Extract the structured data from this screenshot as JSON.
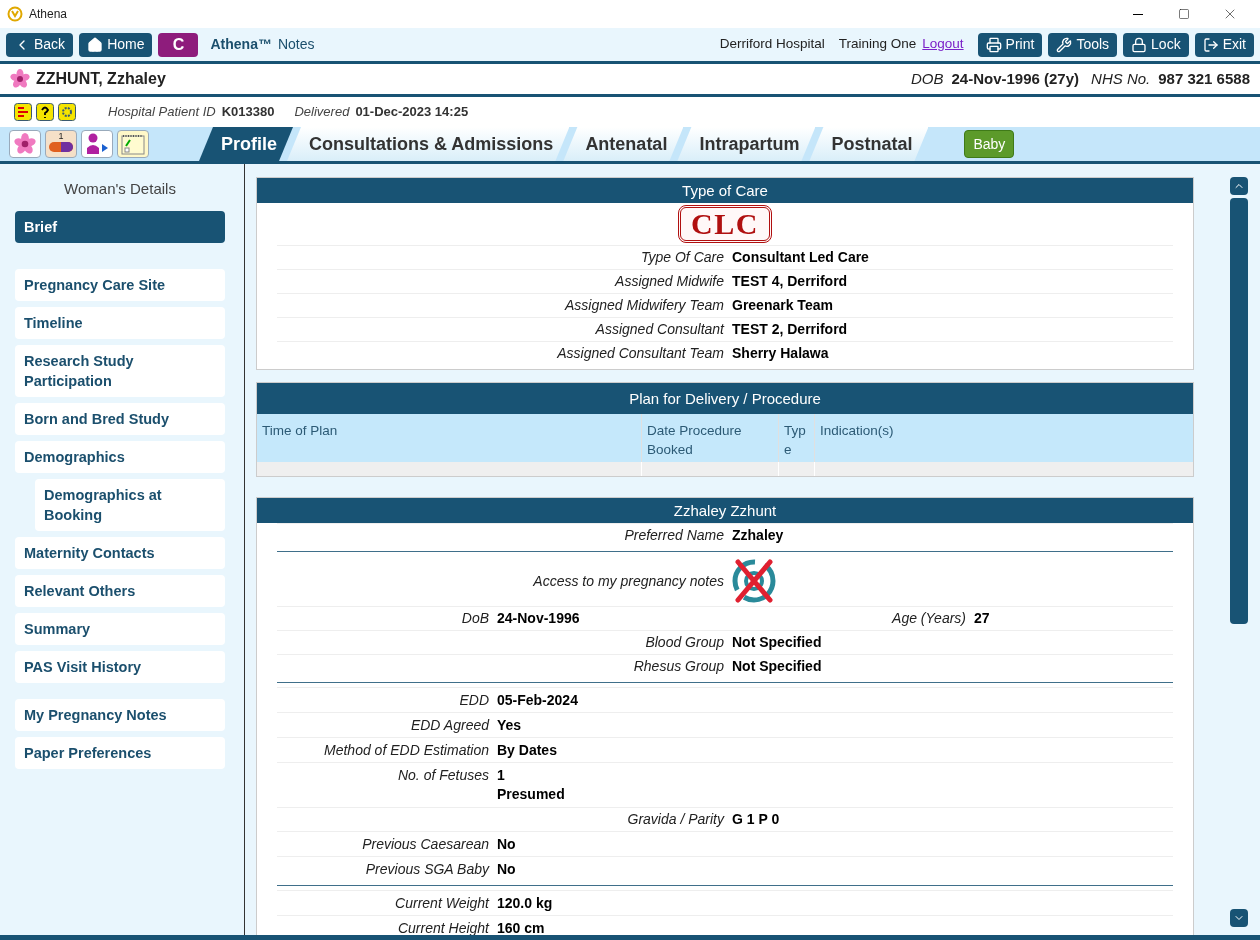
{
  "window": {
    "title": "Athena"
  },
  "toolbar": {
    "left_buttons": [
      {
        "kind": "back",
        "label": "Back"
      },
      {
        "kind": "home",
        "label": "Home"
      }
    ],
    "badge": "C",
    "app_name": "Athena™",
    "app_suffix": "Notes",
    "hospital": "Derriford Hospital",
    "user": "Training One",
    "logout": "Logout",
    "right_buttons": [
      {
        "kind": "print",
        "label": "Print"
      },
      {
        "kind": "tools",
        "label": "Tools"
      },
      {
        "kind": "lock",
        "label": "Lock"
      },
      {
        "kind": "exit",
        "label": "Exit"
      }
    ]
  },
  "patient": {
    "name": "ZZHUNT, Zzhaley",
    "dob_label": "DOB",
    "dob": "24-Nov-1996 (27y)",
    "nhs_label": "NHS No.",
    "nhs": "987 321 6588",
    "id_label": "Hospital Patient ID",
    "id": "K013380",
    "delivered_label": "Delivered",
    "delivered": "01-Dec-2023 14:25"
  },
  "tool_icons": {
    "pill_count": "1"
  },
  "tabs": [
    {
      "label": "Profile",
      "selected": true
    },
    {
      "label": "Consultations & Admissions",
      "selected": false
    },
    {
      "label": "Antenatal",
      "selected": false
    },
    {
      "label": "Intrapartum",
      "selected": false
    },
    {
      "label": "Postnatal",
      "selected": false
    }
  ],
  "baby_button": "Baby",
  "sidebar": {
    "heading": "Woman's Details",
    "groups": [
      [
        {
          "label": "Brief",
          "selected": true
        }
      ],
      [
        {
          "label": "Pregnancy Care Site",
          "selected": false
        },
        {
          "label": "Timeline",
          "selected": false
        },
        {
          "label": "Research Study Participation",
          "selected": false
        },
        {
          "label": "Born and Bred Study",
          "selected": false
        },
        {
          "label": "Demographics",
          "selected": false,
          "children": [
            {
              "label": "Demographics at Booking",
              "selected": false
            }
          ]
        },
        {
          "label": "Maternity Contacts",
          "selected": false
        },
        {
          "label": "Relevant Others",
          "selected": false
        },
        {
          "label": "Summary",
          "selected": false
        },
        {
          "label": "PAS Visit History",
          "selected": false
        }
      ],
      [
        {
          "label": "My Pregnancy Notes",
          "selected": false
        },
        {
          "label": "Paper Preferences",
          "selected": false
        }
      ]
    ]
  },
  "type_of_care": {
    "title": "Type of Care",
    "stamp": "CLC",
    "rows": [
      {
        "label": "Type Of Care",
        "value": "Consultant Led Care"
      },
      {
        "label": "Assigned Midwife",
        "value": "TEST 4, Derriford"
      },
      {
        "label": "Assigned Midwifery Team",
        "value": "Greenark Team"
      },
      {
        "label": "Assigned Consultant",
        "value": "TEST 2, Derriford"
      },
      {
        "label": "Assigned Consultant Team",
        "value": "Sherry Halawa"
      }
    ]
  },
  "plan": {
    "title": "Plan for Delivery / Procedure",
    "columns": [
      "Time of Plan",
      "Date Procedure Booked",
      "Typ e",
      "Indication(s)"
    ]
  },
  "details": {
    "title": "Zzhaley Zzhunt",
    "rows": [
      {
        "kind": "center",
        "label": "Preferred Name",
        "value": "Zzhaley"
      },
      {
        "kind": "divider"
      },
      {
        "kind": "icon",
        "label": "Access to my pregnancy notes"
      },
      {
        "kind": "pair",
        "label": "DoB",
        "value": "24-Nov-1996",
        "label2": "Age (Years)",
        "value2": "27"
      },
      {
        "kind": "center",
        "label": "Blood Group",
        "value": "Not Specified"
      },
      {
        "kind": "center",
        "label": "Rhesus Group",
        "value": "Not Specified"
      },
      {
        "kind": "divider"
      },
      {
        "kind": "left",
        "label": "EDD",
        "value": "05-Feb-2024"
      },
      {
        "kind": "left",
        "label": "EDD Agreed",
        "value": "Yes"
      },
      {
        "kind": "left",
        "label": "Method of EDD Estimation",
        "value": "By Dates"
      },
      {
        "kind": "left",
        "label": "No. of Fetuses",
        "value": "1",
        "value_line2": "Presumed"
      },
      {
        "kind": "center",
        "label": "Gravida / Parity",
        "value": "G 1 P 0"
      },
      {
        "kind": "left",
        "label": "Previous Caesarean",
        "value": "No"
      },
      {
        "kind": "left",
        "label": "Previous SGA Baby",
        "value": "No"
      },
      {
        "kind": "divider"
      },
      {
        "kind": "left",
        "label": "Current Weight",
        "value": "120.0 kg"
      },
      {
        "kind": "left",
        "label": "Current Height",
        "value": "160 cm"
      }
    ]
  }
}
